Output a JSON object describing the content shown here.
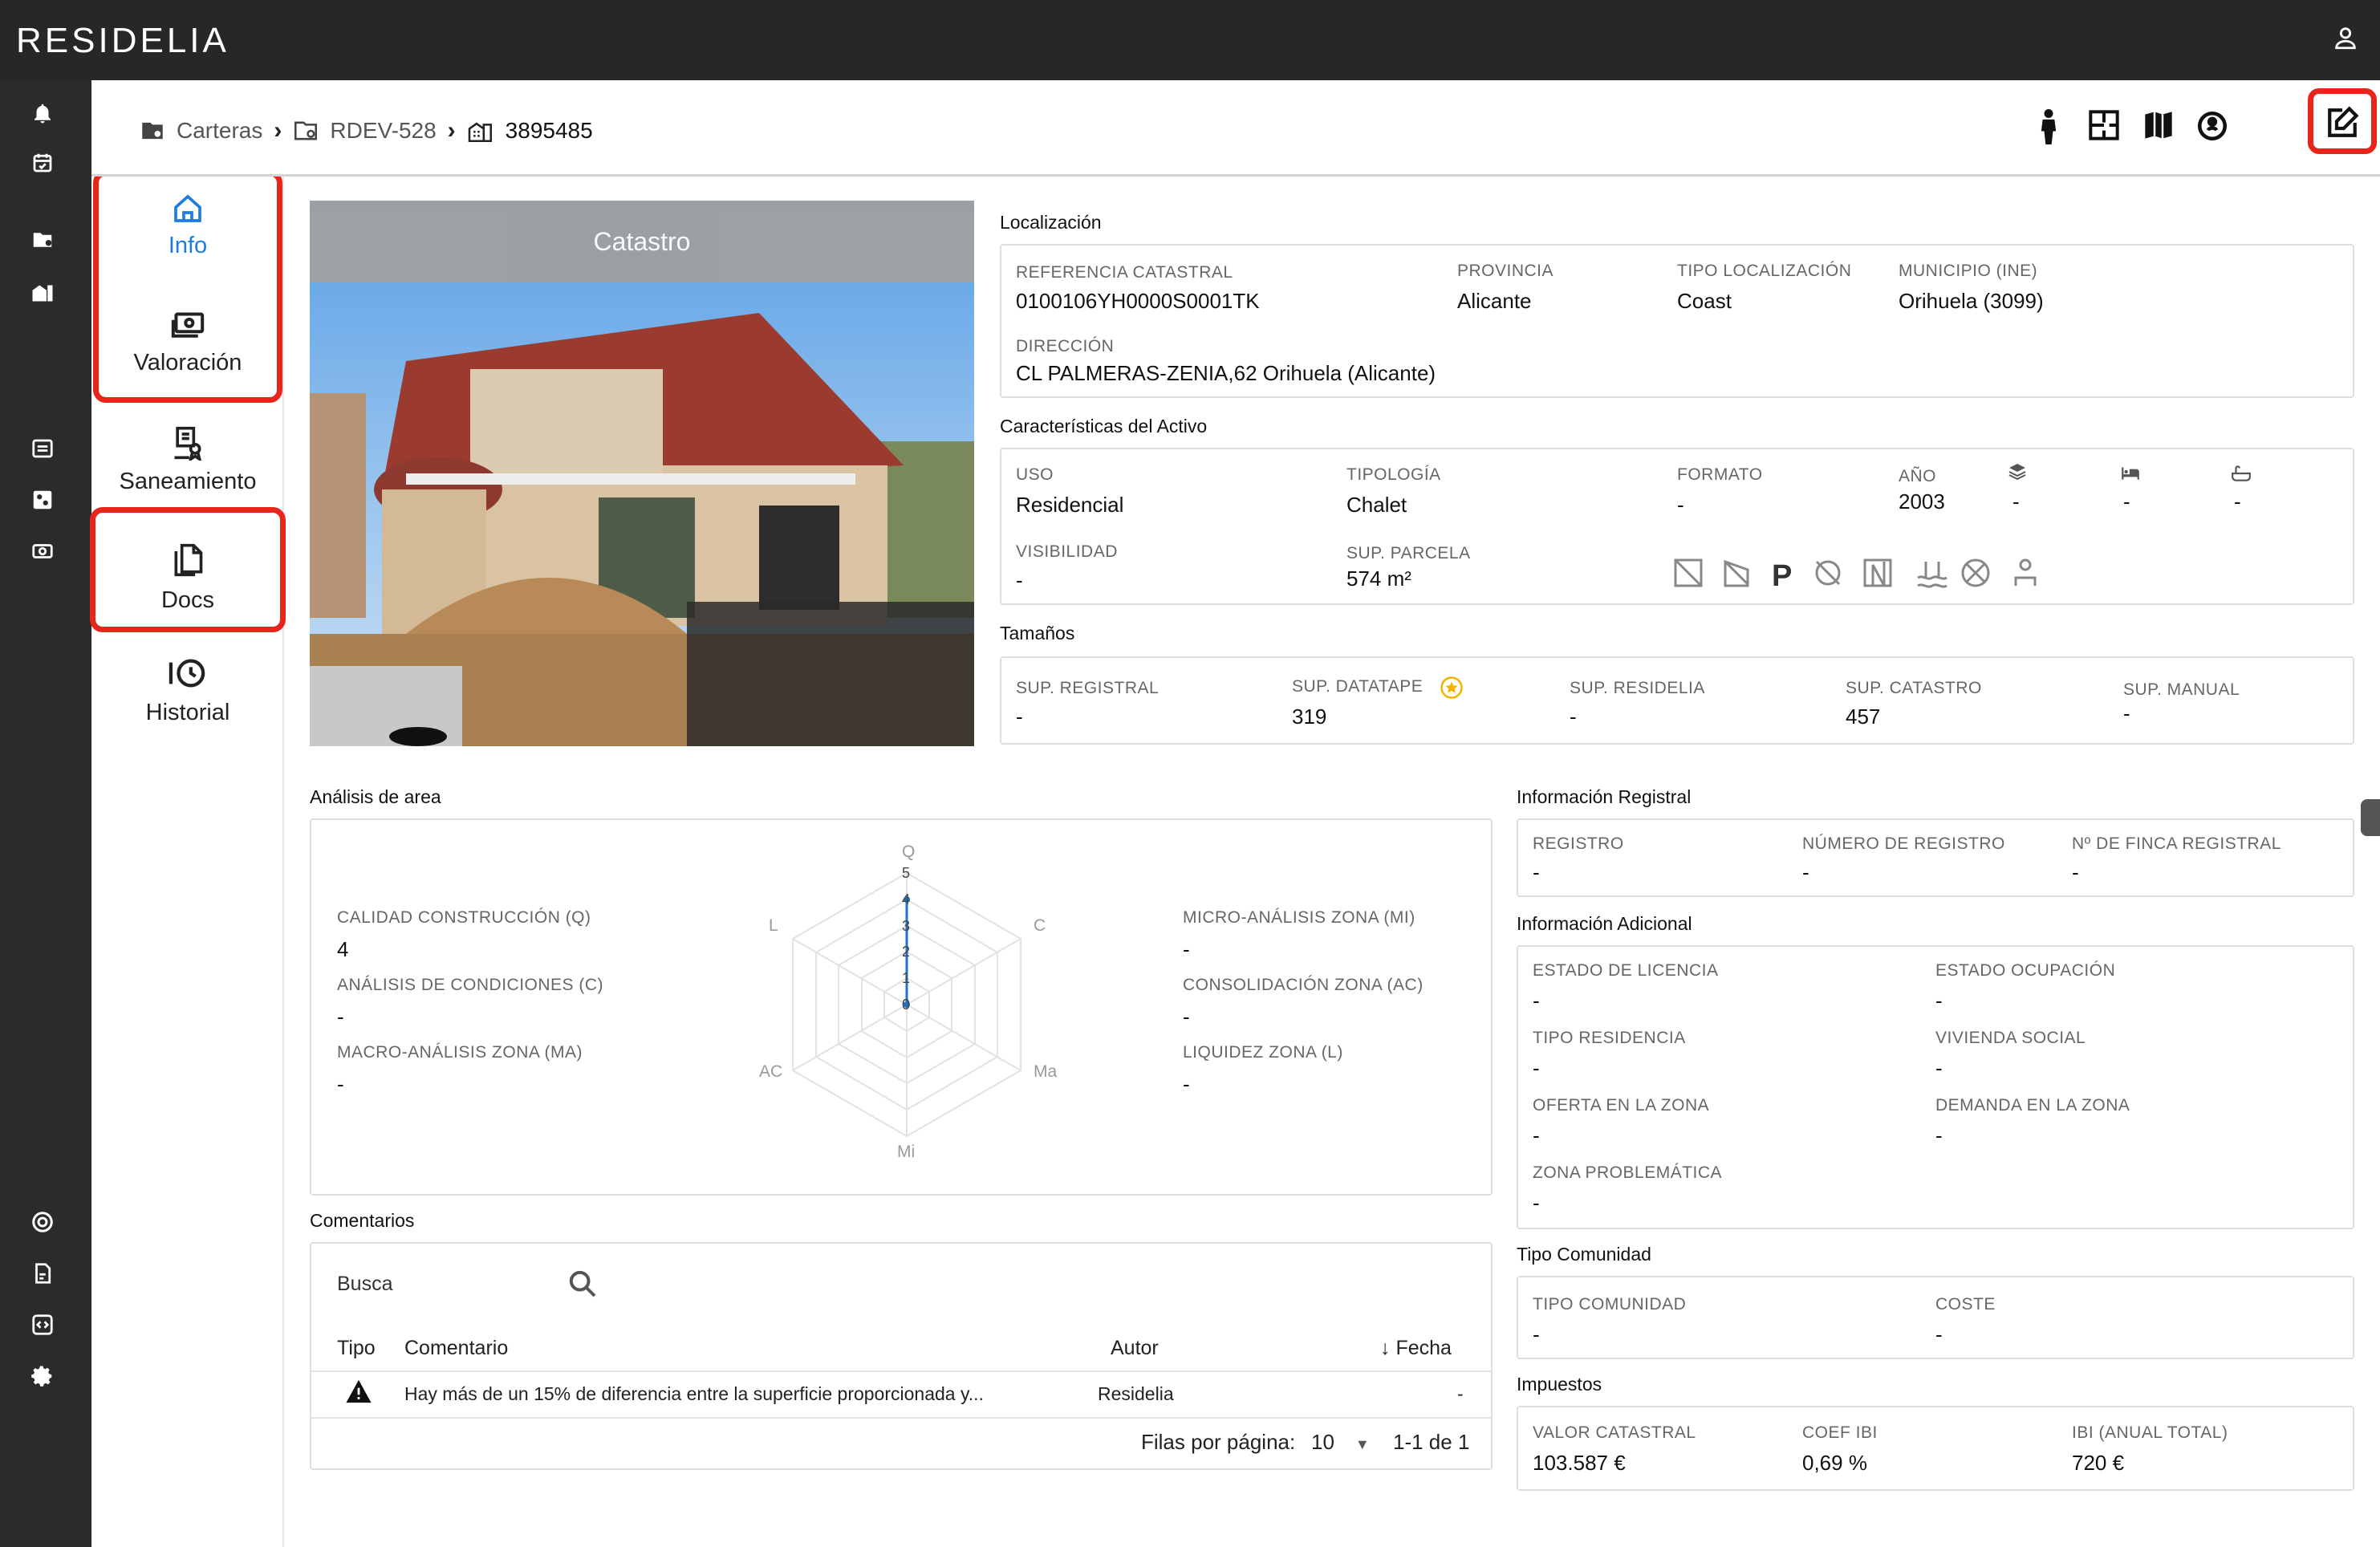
{
  "app": {
    "logo": "RESIDELIA"
  },
  "breadcrumb": {
    "items": [
      "Carteras",
      "RDEV-528",
      "3895485"
    ]
  },
  "subnav": {
    "items": [
      {
        "label": "Info"
      },
      {
        "label": "Valoración"
      },
      {
        "label": "Saneamiento"
      },
      {
        "label": "Docs"
      },
      {
        "label": "Historial"
      }
    ]
  },
  "photo": {
    "banner": "Catastro"
  },
  "localizacion": {
    "title": "Localización",
    "ref_label": "REFERENCIA CATASTRAL",
    "ref_value": "0100106YH0000S0001TK",
    "provincia_label": "PROVINCIA",
    "provincia_value": "Alicante",
    "tipo_label": "TIPO LOCALIZACIÓN",
    "tipo_value": "Coast",
    "municipio_label": "MUNICIPIO (INE)",
    "municipio_value": "Orihuela (3099)",
    "direccion_label": "DIRECCIÓN",
    "direccion_value": "CL PALMERAS-ZENIA,62 Orihuela (Alicante)"
  },
  "caracteristicas": {
    "title": "Características del Activo",
    "uso_label": "USO",
    "uso_value": "Residencial",
    "tipologia_label": "TIPOLOGÍA",
    "tipologia_value": "Chalet",
    "formato_label": "FORMATO",
    "formato_value": "-",
    "anio_label": "AÑO",
    "anio_value": "2003",
    "plantas_value": "-",
    "dormitorios_value": "-",
    "banos_value": "-",
    "visibilidad_label": "VISIBILIDAD",
    "visibilidad_value": "-",
    "parcela_label": "SUP. PARCELA",
    "parcela_value": "574 m²"
  },
  "tamanos": {
    "title": "Tamaños",
    "items": [
      {
        "label": "SUP. REGISTRAL",
        "value": "-"
      },
      {
        "label": "SUP. DATATAPE",
        "value": "319"
      },
      {
        "label": "SUP. RESIDELIA",
        "value": "-"
      },
      {
        "label": "SUP. CATASTRO",
        "value": "457"
      },
      {
        "label": "SUP. MANUAL",
        "value": "-"
      }
    ]
  },
  "analisis": {
    "title": "Análisis de area",
    "left": [
      {
        "label": "CALIDAD CONSTRUCCIÓN (Q)",
        "value": "4"
      },
      {
        "label": "ANÁLISIS DE CONDICIONES (C)",
        "value": "-"
      },
      {
        "label": "MACRO-ANÁLISIS ZONA (MA)",
        "value": "-"
      }
    ],
    "right": [
      {
        "label": "MICRO-ANÁLISIS ZONA (MI)",
        "value": "-"
      },
      {
        "label": "CONSOLIDACIÓN ZONA (AC)",
        "value": "-"
      },
      {
        "label": "LIQUIDEZ ZONA (L)",
        "value": "-"
      }
    ],
    "radar_axes": [
      "Q",
      "C",
      "Ma",
      "Mi",
      "AC",
      "L"
    ],
    "radar_ticks": [
      "5",
      "4",
      "3",
      "2",
      "1",
      "0"
    ]
  },
  "comentarios": {
    "title": "Comentarios",
    "search_placeholder": "Busca",
    "headers": {
      "tipo": "Tipo",
      "comentario": "Comentario",
      "autor": "Autor",
      "fecha": "Fecha"
    },
    "rows": [
      {
        "comentario": "Hay más de un 15% de diferencia entre la superficie proporcionada y...",
        "autor": "Residelia",
        "fecha": "-"
      }
    ],
    "pager": {
      "rows_label": "Filas por página:",
      "rows_value": "10",
      "range": "1-1 de 1"
    }
  },
  "registral": {
    "title": "Información Registral",
    "items": [
      {
        "label": "REGISTRO",
        "value": "-"
      },
      {
        "label": "NÚMERO DE REGISTRO",
        "value": "-"
      },
      {
        "label": "Nº DE FINCA REGISTRAL",
        "value": "-"
      }
    ]
  },
  "adicional": {
    "title": "Información Adicional",
    "items": [
      {
        "label": "ESTADO DE LICENCIA",
        "value": "-"
      },
      {
        "label": "ESTADO OCUPACIÓN",
        "value": "-"
      },
      {
        "label": "TIPO RESIDENCIA",
        "value": "-"
      },
      {
        "label": "VIVIENDA SOCIAL",
        "value": "-"
      },
      {
        "label": "OFERTA EN LA ZONA",
        "value": "-"
      },
      {
        "label": "DEMANDA EN LA ZONA",
        "value": "-"
      },
      {
        "label": "ZONA PROBLEMÁTICA",
        "value": "-"
      }
    ]
  },
  "comunidad": {
    "title": "Tipo Comunidad",
    "items": [
      {
        "label": "TIPO COMUNIDAD",
        "value": "-"
      },
      {
        "label": "COSTE",
        "value": "-"
      }
    ]
  },
  "impuestos": {
    "title": "Impuestos",
    "items": [
      {
        "label": "VALOR CATASTRAL",
        "value": "103.587 €"
      },
      {
        "label": "COEF IBI",
        "value": "0,69 %"
      },
      {
        "label": "IBI (ANUAL TOTAL)",
        "value": "720 €"
      }
    ]
  }
}
